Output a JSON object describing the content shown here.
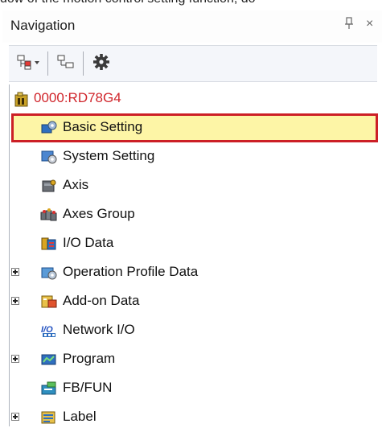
{
  "caption_text": "dow of the motion control setting function, do",
  "panel": {
    "title": "Navigation",
    "pin_glyph": "↑",
    "close_glyph": "×"
  },
  "toolbar": {
    "buttons": [
      {
        "icon": "expand-tree-icon"
      },
      {
        "icon": "collapse-tree-icon"
      },
      {
        "icon": "gear-icon"
      }
    ]
  },
  "tree": {
    "root": {
      "label": "0000:RD78G4",
      "color": "#d0252b"
    },
    "items": [
      {
        "label": "Basic Setting",
        "icon": "basic-setting-icon",
        "selected": true
      },
      {
        "label": "System Setting",
        "icon": "system-setting-icon"
      },
      {
        "label": "Axis",
        "icon": "axis-icon"
      },
      {
        "label": "Axes Group",
        "icon": "axes-group-icon"
      },
      {
        "label": "I/O Data",
        "icon": "io-data-icon"
      },
      {
        "label": "Operation Profile Data",
        "icon": "operation-profile-icon",
        "expandable": true
      },
      {
        "label": "Add-on Data",
        "icon": "add-on-icon",
        "expandable": true
      },
      {
        "label": "Network I/O",
        "icon": "network-io-icon"
      },
      {
        "label": "Program",
        "icon": "program-icon",
        "expandable": true
      },
      {
        "label": "FB/FUN",
        "icon": "fb-fun-icon"
      },
      {
        "label": "Label",
        "icon": "label-icon",
        "expandable": true
      }
    ]
  },
  "colors": {
    "selection_border": "#cc1f26",
    "selection_fill": "#fdf5a6",
    "root_text": "#d0252b"
  }
}
